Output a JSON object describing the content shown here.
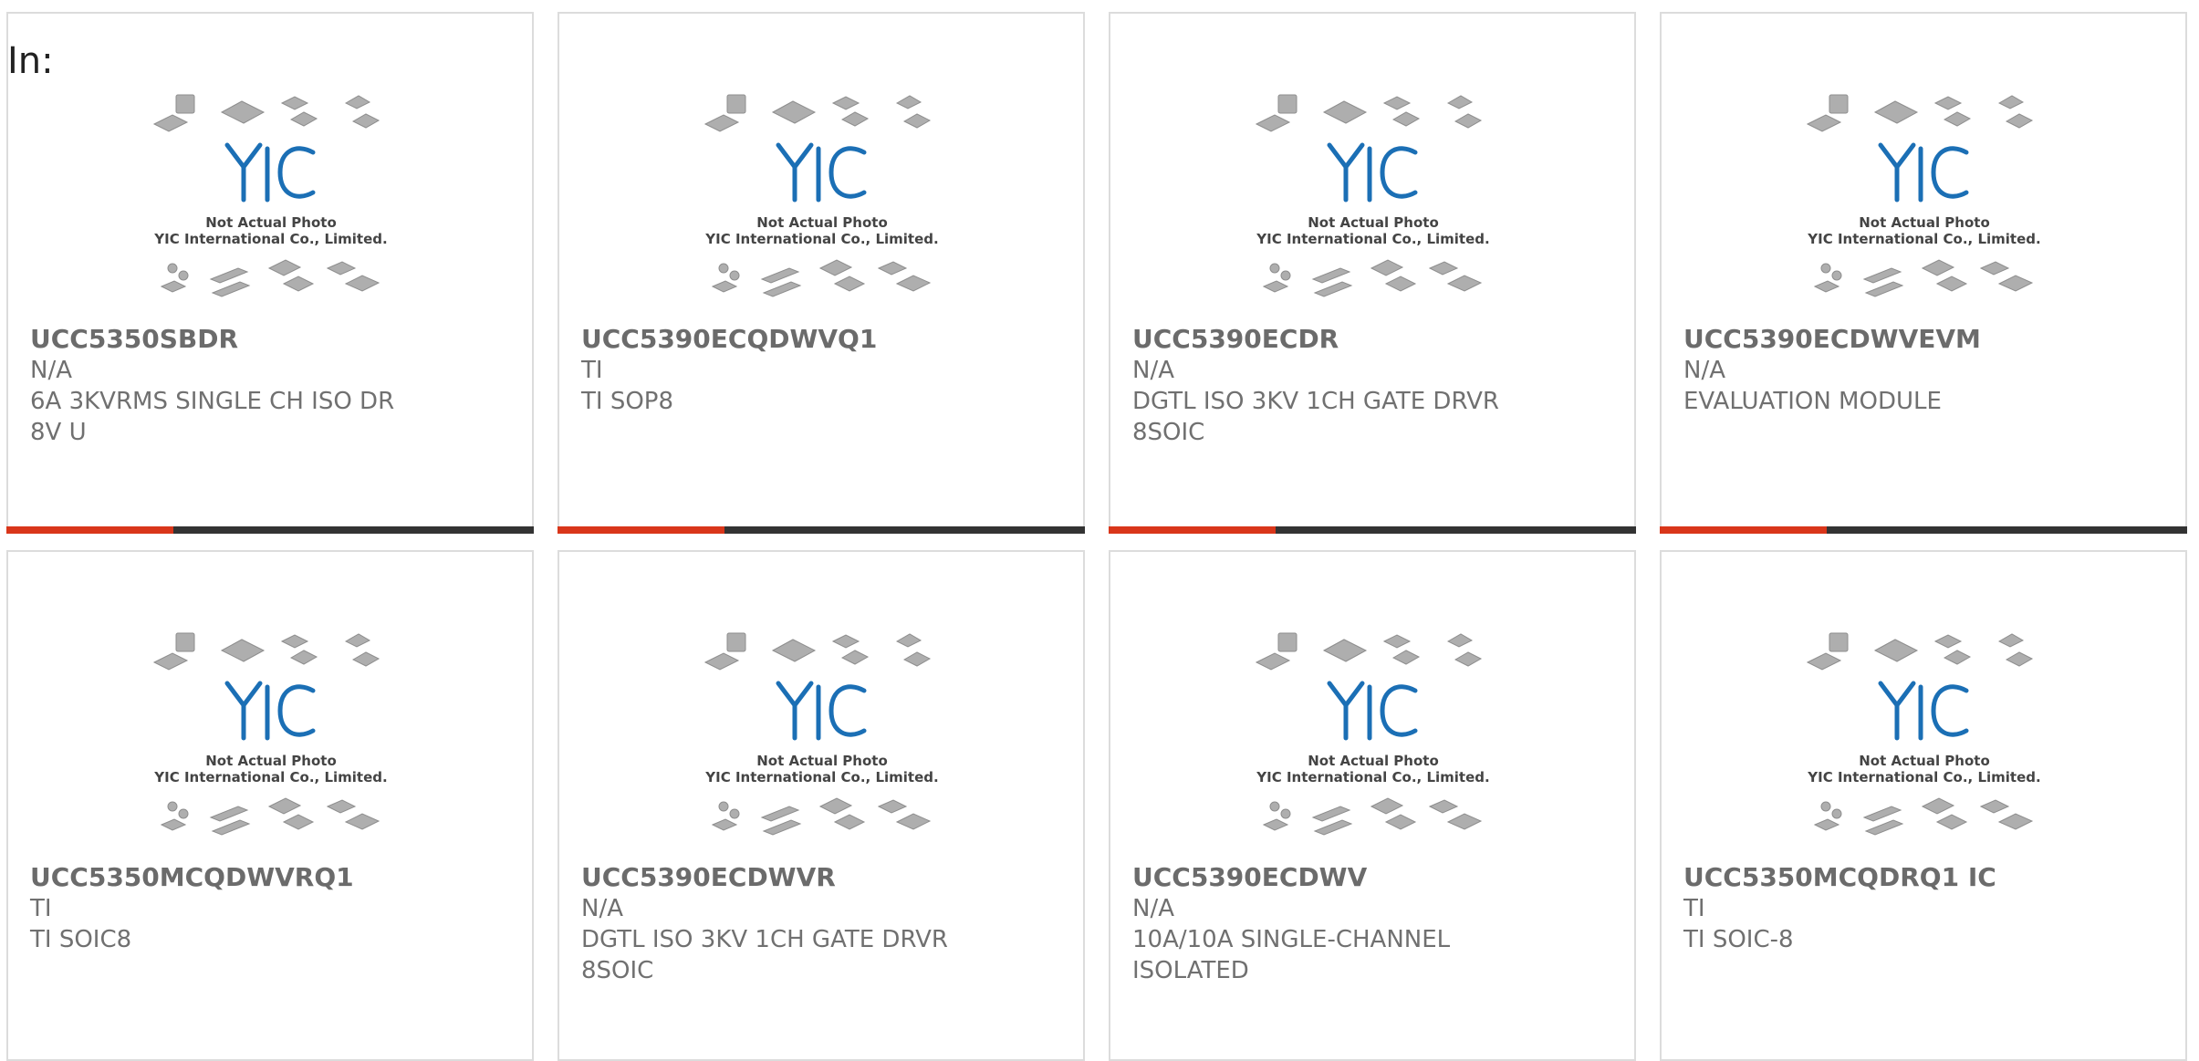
{
  "header": {
    "label": "In:"
  },
  "placeholder_image": {
    "caption_line1": "Not Actual Photo",
    "caption_line2": "YIC International Co., Limited.",
    "logo_text": "YIC",
    "logo_color": "#1b6fb5"
  },
  "colors": {
    "accent_orange": "#d9361a",
    "accent_dark": "#333333",
    "border": "#dcdcdc",
    "text": "#6b6b6b"
  },
  "products": [
    {
      "part_number": "UCC5350SBDR",
      "manufacturer": "N/A",
      "description": "6A 3KVRMS SINGLE CH ISO DR 8V U"
    },
    {
      "part_number": "UCC5390ECQDWVQ1",
      "manufacturer": "TI",
      "description": "TI SOP8"
    },
    {
      "part_number": "UCC5390ECDR",
      "manufacturer": "N/A",
      "description": "DGTL ISO 3KV 1CH GATE DRVR 8SOIC"
    },
    {
      "part_number": "UCC5390ECDWVEVM",
      "manufacturer": "N/A",
      "description": "EVALUATION MODULE"
    },
    {
      "part_number": "UCC5350MCQDWVRQ1",
      "manufacturer": "TI",
      "description": "TI SOIC8"
    },
    {
      "part_number": "UCC5390ECDWVR",
      "manufacturer": "N/A",
      "description": "DGTL ISO 3KV 1CH GATE DRVR 8SOIC"
    },
    {
      "part_number": "UCC5390ECDWV",
      "manufacturer": "N/A",
      "description": "10A/10A SINGLE-CHANNEL ISOLATED"
    },
    {
      "part_number": "UCC5350MCQDRQ1 IC",
      "manufacturer": "TI",
      "description": "TI SOIC-8"
    }
  ]
}
